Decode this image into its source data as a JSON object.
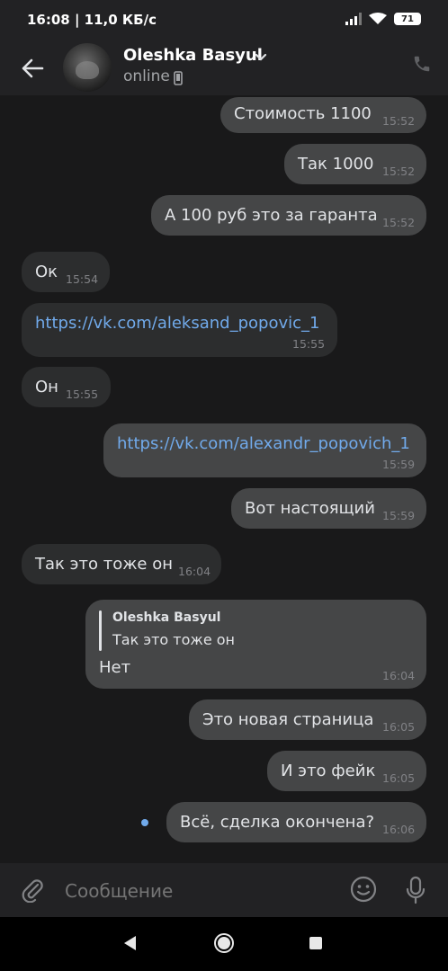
{
  "status_bar": {
    "time": "16:08 | 11,0 КБ/с",
    "battery": "71"
  },
  "header": {
    "contact_name": "Oleshka Basyul",
    "status": "online",
    "icons": [
      "back-arrow-icon",
      "chevron-down-icon",
      "mobile-icon",
      "phone-icon"
    ]
  },
  "messages": [
    {
      "id": "m1",
      "dir": "out",
      "text": "Стоимость 1100",
      "time": "15:52"
    },
    {
      "id": "m2",
      "dir": "out",
      "text": "Так 1000",
      "time": "15:52"
    },
    {
      "id": "m3",
      "dir": "out",
      "text": "А 100 руб это за гаранта",
      "time": "15:52"
    },
    {
      "id": "m4",
      "dir": "in",
      "text": "Ок",
      "time": "15:54"
    },
    {
      "id": "m5",
      "dir": "in",
      "text": "https://vk.com/aleksand_popovic_1",
      "time": "15:55",
      "link": true
    },
    {
      "id": "m6",
      "dir": "in",
      "text": "Он",
      "time": "15:55"
    },
    {
      "id": "m7",
      "dir": "out",
      "text": "https://vk.com/alexandr_popovich_1",
      "time": "15:59",
      "link": true
    },
    {
      "id": "m8",
      "dir": "out",
      "text": "Вот настоящий",
      "time": "15:59"
    },
    {
      "id": "m9",
      "dir": "in",
      "text": "Так это тоже он",
      "time": "16:04"
    },
    {
      "id": "m10",
      "dir": "out",
      "text": "Нет",
      "time": "16:04",
      "reply": {
        "name": "Oleshka Basyul",
        "text": "Так это тоже он"
      }
    },
    {
      "id": "m11",
      "dir": "out",
      "text": "Это новая страница",
      "time": "16:05"
    },
    {
      "id": "m12",
      "dir": "out",
      "text": "И это фейк",
      "time": "16:05"
    },
    {
      "id": "m13",
      "dir": "out",
      "text": "Всё, сделка окончена?",
      "time": "16:06",
      "unread": true
    }
  ],
  "composer": {
    "placeholder": "Сообщение",
    "icons": [
      "paperclip-icon",
      "emoji-icon",
      "microphone-icon"
    ]
  },
  "nav_bar": {
    "icons": [
      "nav-back-icon",
      "nav-home-icon",
      "nav-recents-icon"
    ]
  }
}
